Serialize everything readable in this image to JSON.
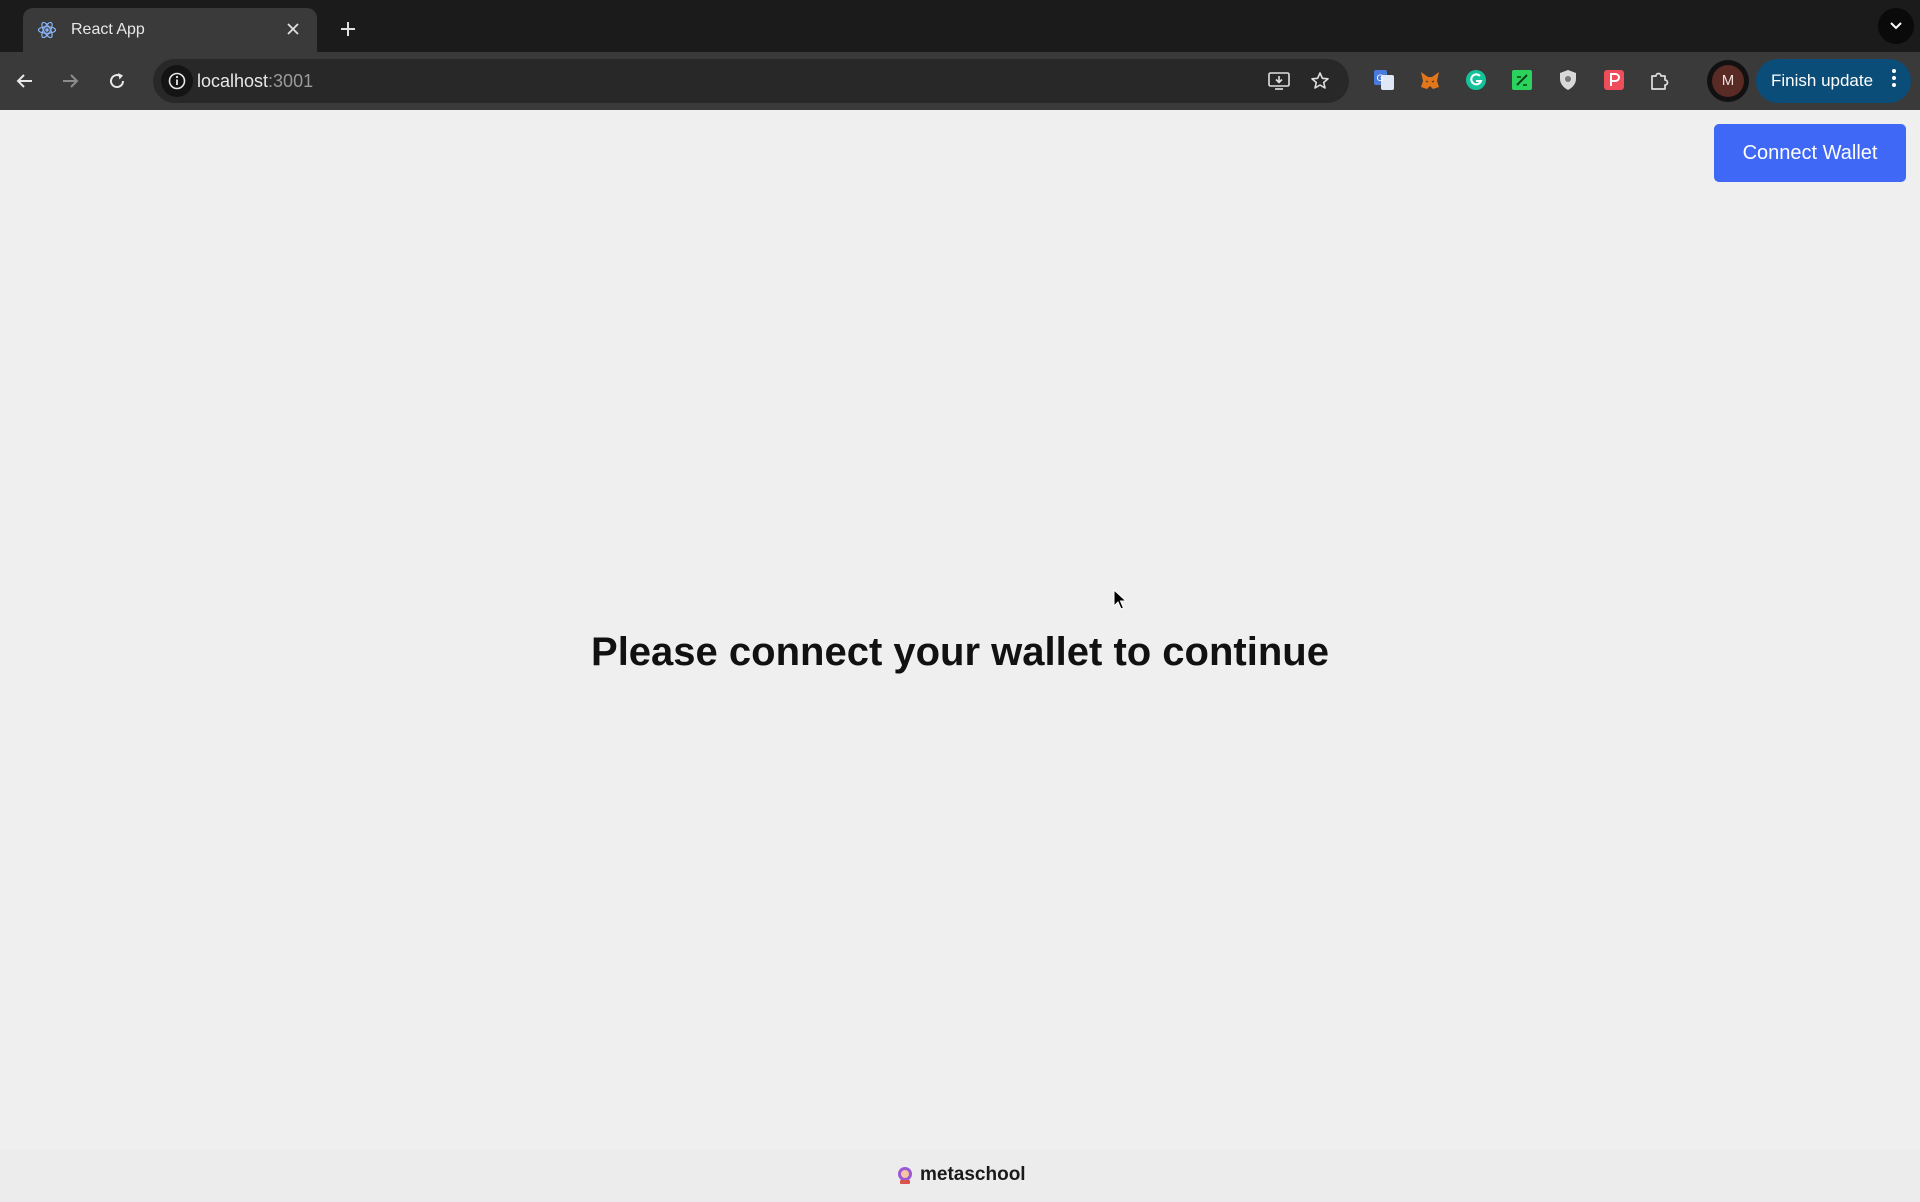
{
  "browser": {
    "tab": {
      "title": "React App"
    },
    "address": {
      "host": "localhost",
      "port": ":3001"
    },
    "finish_update_label": "Finish update",
    "profile_initial": "M",
    "icons": {
      "tab_favicon": "react-logo-icon",
      "close": "close-icon",
      "new_tab": "plus-icon",
      "tab_list": "chevron-down-icon",
      "back": "arrow-left-icon",
      "forward": "arrow-right-icon",
      "reload": "reload-icon",
      "site_info": "info-icon",
      "install": "install-app-icon",
      "bookmark": "star-icon",
      "extensions": [
        "google-translate-icon",
        "metamask-icon",
        "grammarly-icon",
        "green-extension-icon",
        "shield-extension-icon",
        "red-extension-icon",
        "puzzle-icon"
      ],
      "menu": "kebab-menu-icon"
    }
  },
  "page": {
    "connect_wallet_label": "Connect Wallet",
    "headline": "Please connect your wallet to continue",
    "footer_brand": "metaschool"
  },
  "colors": {
    "connect_button": "#3e68f5",
    "page_background": "#efefef",
    "finish_update_button": "#0a4d78"
  }
}
